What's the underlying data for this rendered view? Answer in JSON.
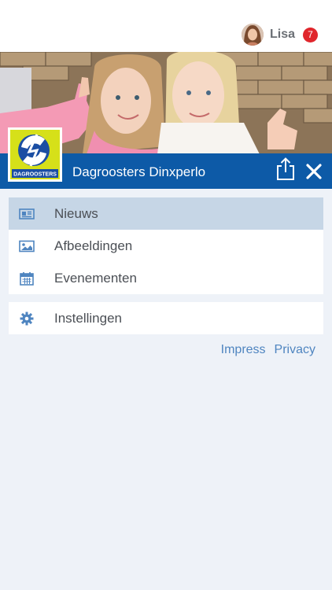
{
  "user": {
    "name": "Lisa",
    "notification_count": "7"
  },
  "header": {
    "org_name": "Dagroosters Dinxperlo",
    "logo_text": "DAGROOSTERS"
  },
  "menu": {
    "items": [
      {
        "label": "Nieuws",
        "icon": "newspaper-icon",
        "active": true
      },
      {
        "label": "Afbeeldingen",
        "icon": "image-icon",
        "active": false
      },
      {
        "label": "Evenementen",
        "icon": "calendar-icon",
        "active": false
      }
    ],
    "settings": {
      "label": "Instellingen",
      "icon": "gear-icon"
    }
  },
  "footer_links": {
    "impress": "Impress",
    "privacy": "Privacy"
  },
  "colors": {
    "brand_blue": "#0d5aa7",
    "active_row": "#c6d6e6",
    "badge_red": "#e0262c",
    "link_blue": "#4f85c0",
    "background": "#eef2f8"
  }
}
